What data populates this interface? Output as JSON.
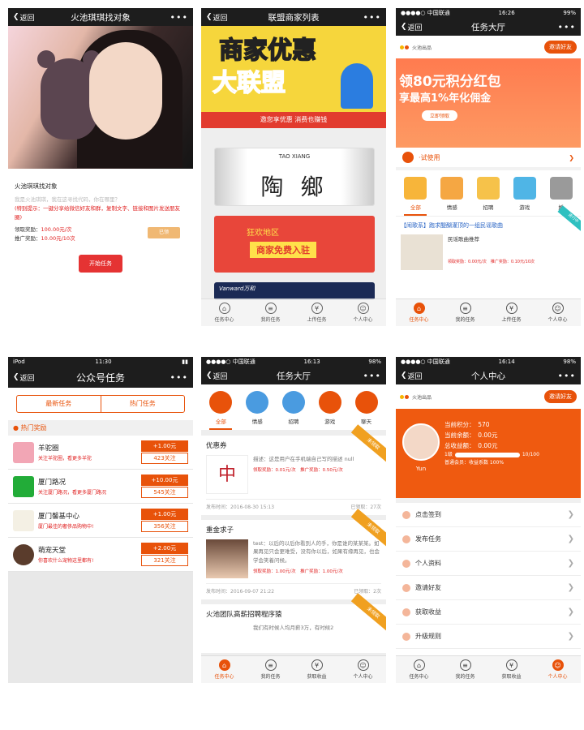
{
  "p1": {
    "back": "返回",
    "title": "火池琪琪找对象",
    "task_title": "火池琪琪找对象",
    "desc": "我是火池琪琪，我在这寻找代码，你在哪里？",
    "tip": "(特别提示：一键分享给微信好友和群，复制文字、链接和图片发送朋友圈)",
    "get_label": "领取奖励：",
    "get_value": "100.00元/次",
    "promo_label": "推广奖励：",
    "promo_value": "10.00元/10次",
    "small_btn": "已领",
    "start": "开始任务"
  },
  "p2": {
    "back": "返回",
    "title": "联盟商家列表",
    "banner_l1": "商家优惠",
    "banner_l2": "大联盟",
    "banner_strip": "邀您享优惠 消费也赚钱",
    "card1_en": "TAO XIANG",
    "card1_zh": "陶 鄉",
    "card2_a": "狂欢地区",
    "card2_b": "商家免费入驻",
    "card3": "Vanward万和",
    "tabs": [
      "任务中心",
      "我的任务",
      "上传任务",
      "个人中心"
    ]
  },
  "p3": {
    "status_carrier": "●●●●○ 中国联通",
    "status_time": "16:26",
    "status_batt": "99%",
    "back": "返回",
    "title": "任务大厅",
    "brand": "火池出品",
    "invite": "邀请好友",
    "promo1": "领80元积分红包",
    "promo2": "享最高1%年化佣金",
    "promo_btn": "立即领取",
    "trial": "·试使用",
    "cats": [
      "全部",
      "情感",
      "招聘",
      "游戏",
      "婚"
    ],
    "news": "【闹歌系】跑求醍醐灌顶的一组民谣歌曲",
    "ribbon": "进行中",
    "item_title": "民谣歌曲推荐",
    "item_reward": "领取奖励：0.00元/次　推广奖励：0.10元/10次",
    "tabs": [
      "任务中心",
      "我的任务",
      "上传任务",
      "个人中心"
    ]
  },
  "p4": {
    "status_l": "iPod",
    "status_time": "11:30",
    "back": "返回",
    "title": "公众号任务",
    "seg1": "最新任务",
    "seg2": "热门任务",
    "hot": "热门奖励",
    "accounts": [
      {
        "name": "羊驼圈",
        "desc": "关注羊驼圈，看更多羊驼",
        "amt": "+1.00元",
        "fans": "423关注",
        "color": "#f2a6b5"
      },
      {
        "name": "厦门路况",
        "desc": "关注厦门路况，看更多厦门路况",
        "amt": "+10.00元",
        "fans": "545关注",
        "color": "#22ac38"
      },
      {
        "name": "厦门馨基中心",
        "desc": "厦门最佳的奢侈品购物中!",
        "amt": "+1.00元",
        "fans": "356关注",
        "color": "#f4f0e4"
      },
      {
        "name": "萌宠天堂",
        "desc": "你喜欢什么宠物这里都有!",
        "amt": "+2.00元",
        "fans": "321关注",
        "color": "#5a3c2c"
      }
    ]
  },
  "p5": {
    "status_carrier": "●●●●○ 中国联通",
    "status_time": "16:13",
    "status_batt": "98%",
    "back": "返回",
    "title": "任务大厅",
    "cats": [
      "全部",
      "情感",
      "招聘",
      "游戏",
      "聊天"
    ],
    "tasks": [
      {
        "title": "优惠券",
        "desc": "描述：这是用户在手机端自己写的描述 null",
        "reward": "领取奖励：0.01元/次　推广奖励：0.50元/次",
        "time": "发布时间：2016-08-30 15:13",
        "count": "已领取：27次",
        "ribbon": "未领取"
      },
      {
        "title": "重金求子",
        "desc": "test：以后的以后你看到人的手，你是谁的某某某。如果再见只会更难受，没有你以后，如果有缘再见，也会学会笑着问候。",
        "reward": "领取奖励：1.00元/次　推广奖励：1.00元/次",
        "time": "发布时间：2016-09-07 21:22",
        "count": "已领取：2次",
        "ribbon": "未领取"
      },
      {
        "title": "火池团队高薪招聘程序猿",
        "desc": "我们有时候人均月薪3万，有时候2",
        "reward": "",
        "time": "",
        "count": "",
        "ribbon": "未领取"
      }
    ],
    "tabs": [
      "任务中心",
      "我的任务",
      "获取收益",
      "个人中心"
    ]
  },
  "p6": {
    "status_carrier": "●●●●○ 中国联通",
    "status_time": "16:14",
    "status_batt": "98%",
    "back": "返回",
    "title": "个人中心",
    "brand": "火池出品",
    "invite": "邀请好友",
    "user": "Yun",
    "points": "当前积分：　570",
    "balance": "当前余额：　0.00元",
    "income": "总收益额：　0.00元",
    "level_l": "1级",
    "level_r": "10/100",
    "member": "普通会员：收益系数 100%",
    "menu": [
      "点击签到",
      "发布任务",
      "个人资料",
      "邀请好友",
      "获取收益",
      "升级规则"
    ],
    "tabs": [
      "任务中心",
      "我的任务",
      "获取收益",
      "个人中心"
    ]
  },
  "colors": {
    "accent": "#e8520a",
    "nav": "#1d1d1d",
    "red": "#e02020"
  }
}
